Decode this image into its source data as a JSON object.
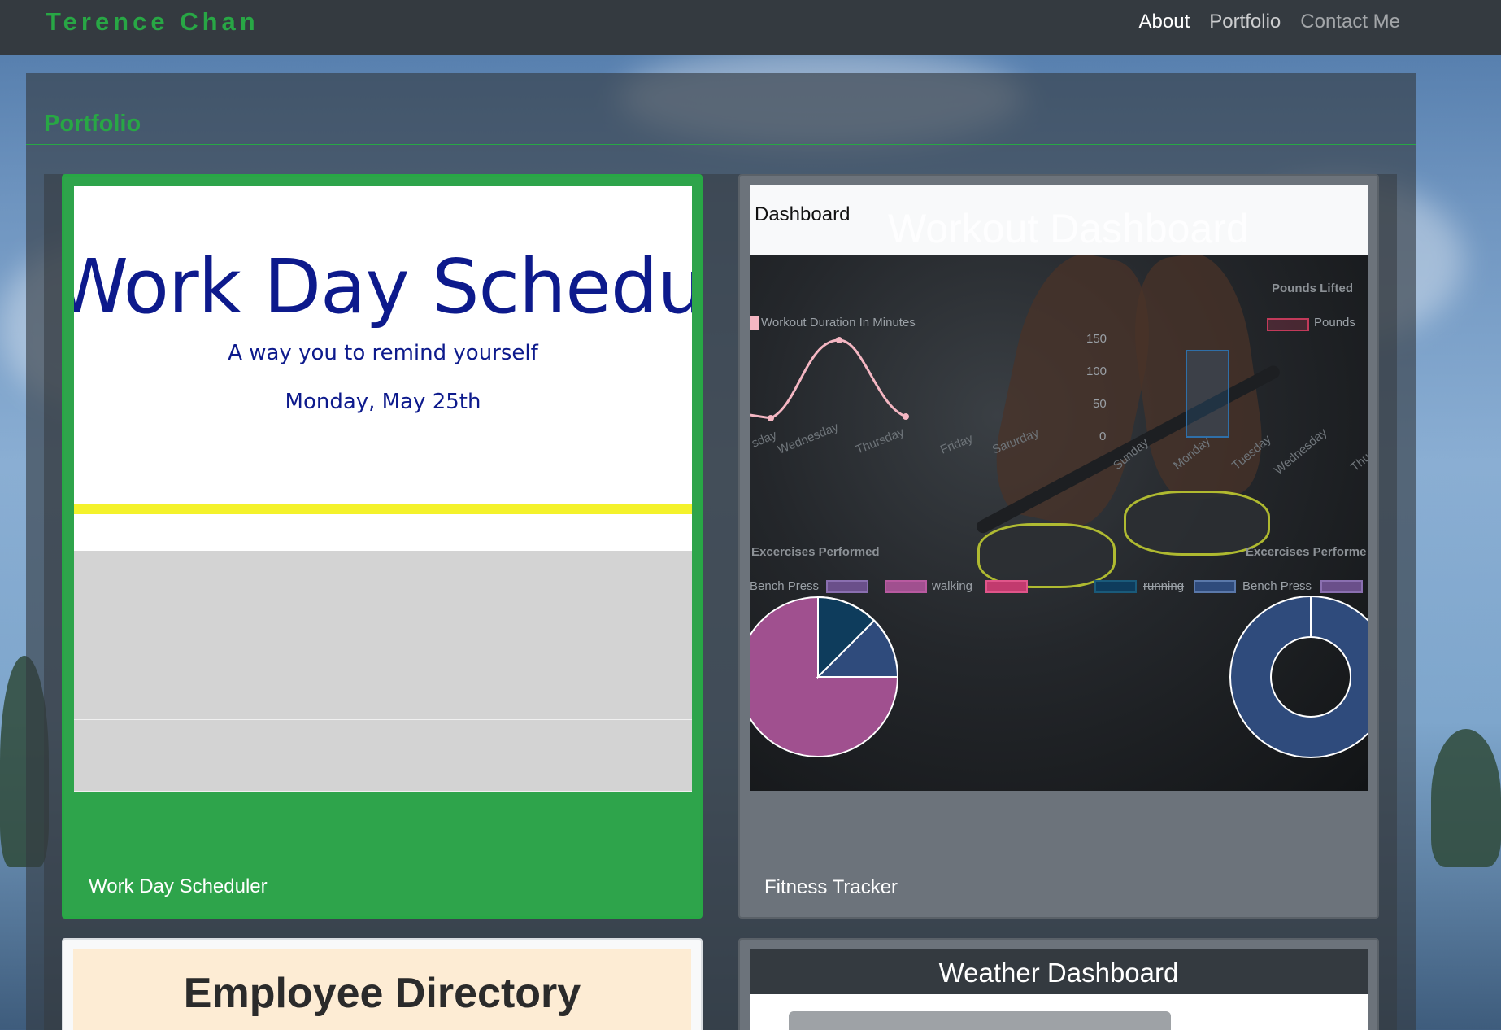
{
  "navbar": {
    "brand": "Terence Chan",
    "links": [
      {
        "label": "About"
      },
      {
        "label": "Portfolio"
      },
      {
        "label": "Contact Me"
      }
    ]
  },
  "section": {
    "title": "Portfolio"
  },
  "projects": [
    {
      "label": "Work Day Scheduler",
      "preview": {
        "title": "Work Day Schedule",
        "subtitle": "A way you to remind yourself",
        "date": "Monday, May 25th"
      }
    },
    {
      "label": "Fitness Tracker",
      "preview": {
        "header_label": "Dashboard",
        "header_title": "Workout Dashboard",
        "line_legend": "Workout Duration In Minutes",
        "bar_title": "Pounds Lifted",
        "bar_legend": "Pounds",
        "bar_ticks": [
          "150",
          "100",
          "50",
          "0"
        ],
        "line_days": [
          "sday",
          "Wednesday",
          "Thursday",
          "Friday",
          "Saturday"
        ],
        "bar_days": [
          "Sunday",
          "Monday",
          "Tuesday",
          "Wednesday",
          "Thur"
        ],
        "pie_title": "Excercises Performed",
        "pie_legend_a": "Bench Press",
        "pie_legend_b": "walking",
        "donut_title": "Excercises Performe",
        "donut_legend_a": "running",
        "donut_legend_b": "Bench Press"
      }
    },
    {
      "label": "",
      "preview": {
        "title": "Employee Directory"
      }
    },
    {
      "label": "",
      "preview": {
        "title": "Weather Dashboard"
      }
    }
  ],
  "colors": {
    "brand_green": "#28a745",
    "navbar": "#343a40",
    "schedule_blue": "#0d1a8c",
    "highlight_yellow": "#f4f22b",
    "pie_purple": "#a0508f",
    "pie_teal": "#0e3c5c",
    "pie_navy": "#2f4b7c"
  }
}
